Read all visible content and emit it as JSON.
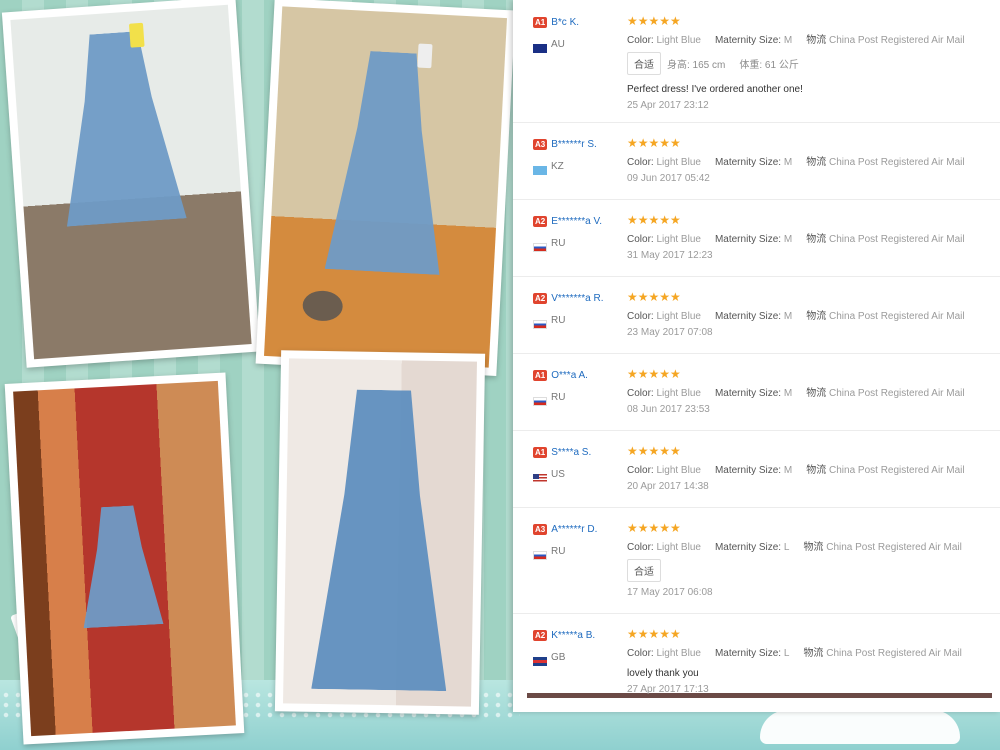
{
  "reviews": [
    {
      "level": "A1",
      "name": "B*c K.",
      "country": "AU",
      "flag": "f-au",
      "stars": "★★★★★",
      "color_label": "Color:",
      "color_value": "Light Blue",
      "size_label": "Maternity Size:",
      "size_value": "M",
      "ship_label": "物流",
      "ship_value": "China Post Registered Air Mail",
      "tags": [
        "合适",
        "身高: 165 cm",
        "体重: 61 公斤"
      ],
      "comment": "Perfect dress! I've ordered another one!",
      "date": "25 Apr 2017 23:12"
    },
    {
      "level": "A3",
      "name": "B******r S.",
      "country": "KZ",
      "flag": "f-kz",
      "stars": "★★★★★",
      "color_label": "Color:",
      "color_value": "Light Blue",
      "size_label": "Maternity Size:",
      "size_value": "M",
      "ship_label": "物流",
      "ship_value": "China Post Registered Air Mail",
      "tags": [],
      "comment": "",
      "date": "09 Jun 2017 05:42"
    },
    {
      "level": "A2",
      "name": "E*******a V.",
      "country": "RU",
      "flag": "f-ru",
      "stars": "★★★★★",
      "color_label": "Color:",
      "color_value": "Light Blue",
      "size_label": "Maternity Size:",
      "size_value": "M",
      "ship_label": "物流",
      "ship_value": "China Post Registered Air Mail",
      "tags": [],
      "comment": "",
      "date": "31 May 2017 12:23"
    },
    {
      "level": "A2",
      "name": "V*******a R.",
      "country": "RU",
      "flag": "f-ru",
      "stars": "★★★★★",
      "color_label": "Color:",
      "color_value": "Light Blue",
      "size_label": "Maternity Size:",
      "size_value": "M",
      "ship_label": "物流",
      "ship_value": "China Post Registered Air Mail",
      "tags": [],
      "comment": "",
      "date": "23 May 2017 07:08"
    },
    {
      "level": "A1",
      "name": "O***a A.",
      "country": "RU",
      "flag": "f-ru",
      "stars": "★★★★★",
      "color_label": "Color:",
      "color_value": "Light Blue",
      "size_label": "Maternity Size:",
      "size_value": "M",
      "ship_label": "物流",
      "ship_value": "China Post Registered Air Mail",
      "tags": [],
      "comment": "",
      "date": "08 Jun 2017 23:53"
    },
    {
      "level": "A1",
      "name": "S****a S.",
      "country": "US",
      "flag": "f-us",
      "stars": "★★★★★",
      "color_label": "Color:",
      "color_value": "Light Blue",
      "size_label": "Maternity Size:",
      "size_value": "M",
      "ship_label": "物流",
      "ship_value": "China Post Registered Air Mail",
      "tags": [],
      "comment": "",
      "date": "20 Apr 2017 14:38"
    },
    {
      "level": "A3",
      "name": "A******r D.",
      "country": "RU",
      "flag": "f-ru",
      "stars": "★★★★★",
      "color_label": "Color:",
      "color_value": "Light Blue",
      "size_label": "Maternity Size:",
      "size_value": "L",
      "ship_label": "物流",
      "ship_value": "China Post Registered Air Mail",
      "tags": [
        "合适"
      ],
      "comment": "",
      "date": "17 May 2017 06:08"
    },
    {
      "level": "A2",
      "name": "K*****a B.",
      "country": "GB",
      "flag": "f-gb",
      "stars": "★★★★★",
      "color_label": "Color:",
      "color_value": "Light Blue",
      "size_label": "Maternity Size:",
      "size_value": "L",
      "ship_label": "物流",
      "ship_value": "China Post Registered Air Mail",
      "tags": [],
      "comment": "lovely thank you",
      "date": "27 Apr 2017 17:13"
    }
  ]
}
